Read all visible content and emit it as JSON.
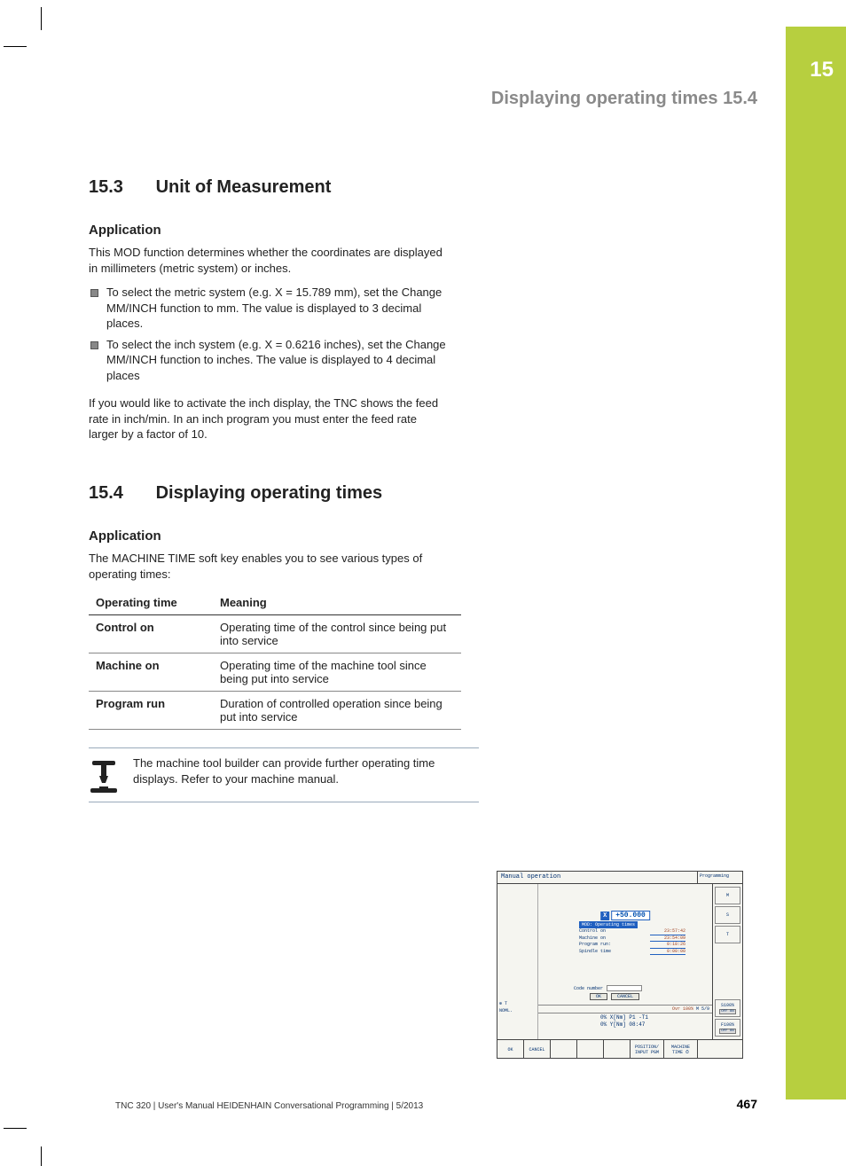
{
  "chapter": {
    "number": "15",
    "running_head": "Displaying operating times   15.4"
  },
  "section_15_3": {
    "heading_num": "15.3",
    "heading_text": "Unit of Measurement",
    "sub": "Application",
    "intro": "This MOD function determines whether the coordinates are displayed in millimeters (metric system) or inches.",
    "bullets": [
      "To select the metric system (e.g. X = 15.789 mm), set the Change MM/INCH function to mm. The value is displayed to 3 decimal places.",
      "To select the inch system (e.g. X = 0.6216 inches), set the Change MM/INCH function to inches. The value is displayed to 4 decimal places"
    ],
    "outro": "If you would like to activate the inch display, the TNC shows the feed rate in inch/min. In an inch program you must enter the feed rate larger by a factor of 10."
  },
  "section_15_4": {
    "heading_num": "15.4",
    "heading_text": "Displaying operating times",
    "sub": "Application",
    "intro": "The MACHINE TIME soft key enables you to see various types of operating times:",
    "table": {
      "headers": [
        "Operating time",
        "Meaning"
      ],
      "rows": [
        {
          "label": "Control on",
          "meaning": "Operating time of the control since being put into service"
        },
        {
          "label": "Machine on",
          "meaning": "Operating time of the machine tool since being put into service"
        },
        {
          "label": "Program run",
          "meaning": "Duration of controlled operation since being put into service"
        }
      ]
    },
    "note": "The machine tool builder can provide further operating time displays. Refer to your machine manual."
  },
  "screenshot": {
    "title_left": "Manual operation",
    "title_right": "Programming",
    "x_label": "X",
    "x_value": "+50.000",
    "mod_title": "MOD: Operating times",
    "mod_rows": [
      {
        "label": "Control on",
        "value": "23:57:42"
      },
      {
        "label": "Machine on",
        "value": "23:54:09"
      },
      {
        "label": "Program run:",
        "value": "0:18:26"
      },
      {
        "label": "Spindle time",
        "value": "0:00:00"
      }
    ],
    "code_label": "Code number",
    "ok_btn": "OK",
    "cancel_btn": "CANCEL",
    "status_strip": {
      "ovr": "Ovr 100%",
      "m": "M 5/9"
    },
    "coord1": "0% X[Nm] P1 -T1",
    "coord2": "0% Y[Nm] 08:47",
    "left_panel": {
      "top": "⊕  T",
      "bottom": "NOML."
    },
    "right_panel": [
      "M",
      "S",
      "T",
      "S100%",
      "F100%"
    ],
    "softkeys": [
      "OK",
      "CANCEL",
      "",
      "",
      "",
      "POSITION/ INPUT PGM",
      "MACHINE TIME ⏱",
      ""
    ]
  },
  "footer": {
    "left": "TNC 320 | User's Manual HEIDENHAIN Conversational Programming | 5/2013",
    "page": "467"
  }
}
